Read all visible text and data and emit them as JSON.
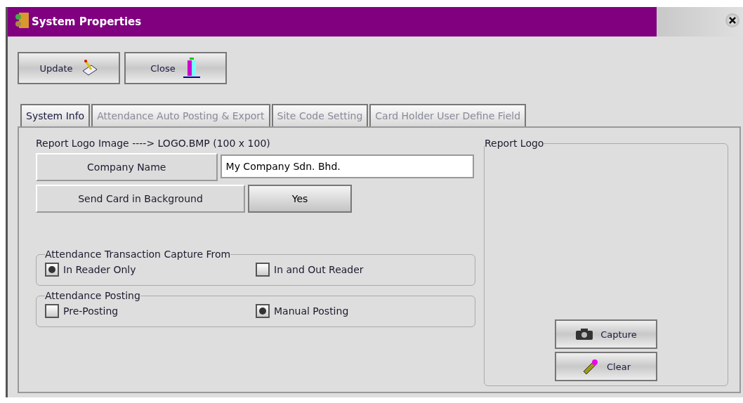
{
  "window": {
    "title": "System Properties"
  },
  "toolbar": [
    {
      "label": "Update",
      "kind": "update"
    },
    {
      "label": "Close",
      "kind": "close"
    }
  ],
  "tabs": [
    {
      "label": "System Info",
      "selected": true
    },
    {
      "label": "Attendance Auto Posting & Export",
      "selected": false
    },
    {
      "label": "Site Code Setting",
      "selected": false
    },
    {
      "label": "Card Holder User Define Field",
      "selected": false
    }
  ],
  "note": "Report Logo Image ----> LOGO.BMP (100 x 100)",
  "fields": [
    {
      "label": "Company Name",
      "kind": "text",
      "value": "My Company Sdn. Bhd."
    },
    {
      "label": "Send Card in Background",
      "kind": "toggle",
      "value": "Yes"
    }
  ],
  "groups": [
    {
      "title": "Attendance Transaction Capture From",
      "options": [
        {
          "label": "In Reader Only",
          "selected": true
        },
        {
          "label": "In and Out Reader",
          "selected": false
        }
      ]
    },
    {
      "title": "Attendance Posting",
      "options": [
        {
          "label": "Pre-Posting",
          "selected": false
        },
        {
          "label": "Manual Posting",
          "selected": true
        }
      ]
    }
  ],
  "logo_panel": {
    "title": "Report Logo",
    "buttons": [
      {
        "label": "Capture",
        "kind": "camera"
      },
      {
        "label": "Clear",
        "kind": "eraser"
      }
    ]
  }
}
